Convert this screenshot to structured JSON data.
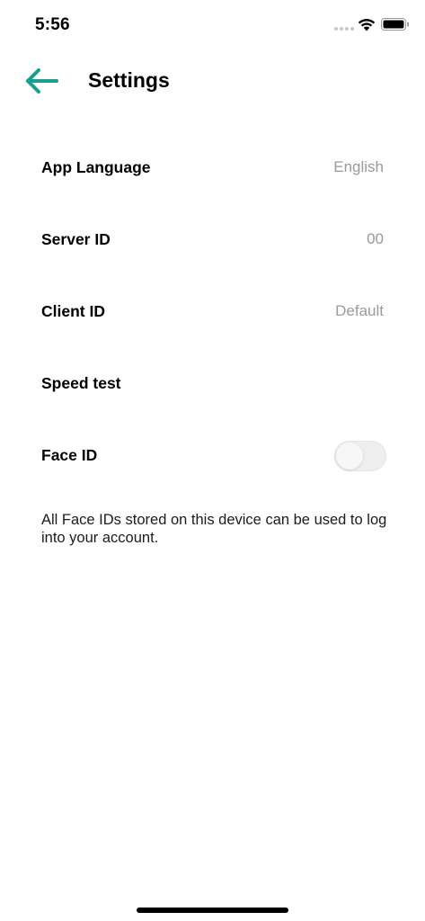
{
  "status_bar": {
    "time": "5:56",
    "icons": [
      "signal-icon",
      "wifi-icon",
      "battery-icon"
    ]
  },
  "header": {
    "back_icon": "arrow-left-icon",
    "title": "Settings"
  },
  "rows": [
    {
      "label": "App Language",
      "value": "English"
    },
    {
      "label": "Server ID",
      "value": "00"
    },
    {
      "label": "Client ID",
      "value": "Default"
    },
    {
      "label": "Speed test",
      "value": ""
    },
    {
      "label": "Face ID",
      "toggle_on": false
    }
  ],
  "face_id_note": "All Face IDs stored on this device can be used to log into your account.",
  "colors": {
    "accent": "#1a9e8f",
    "value_text": "#9a9a9a",
    "toggle_off": "#eeeeee"
  }
}
